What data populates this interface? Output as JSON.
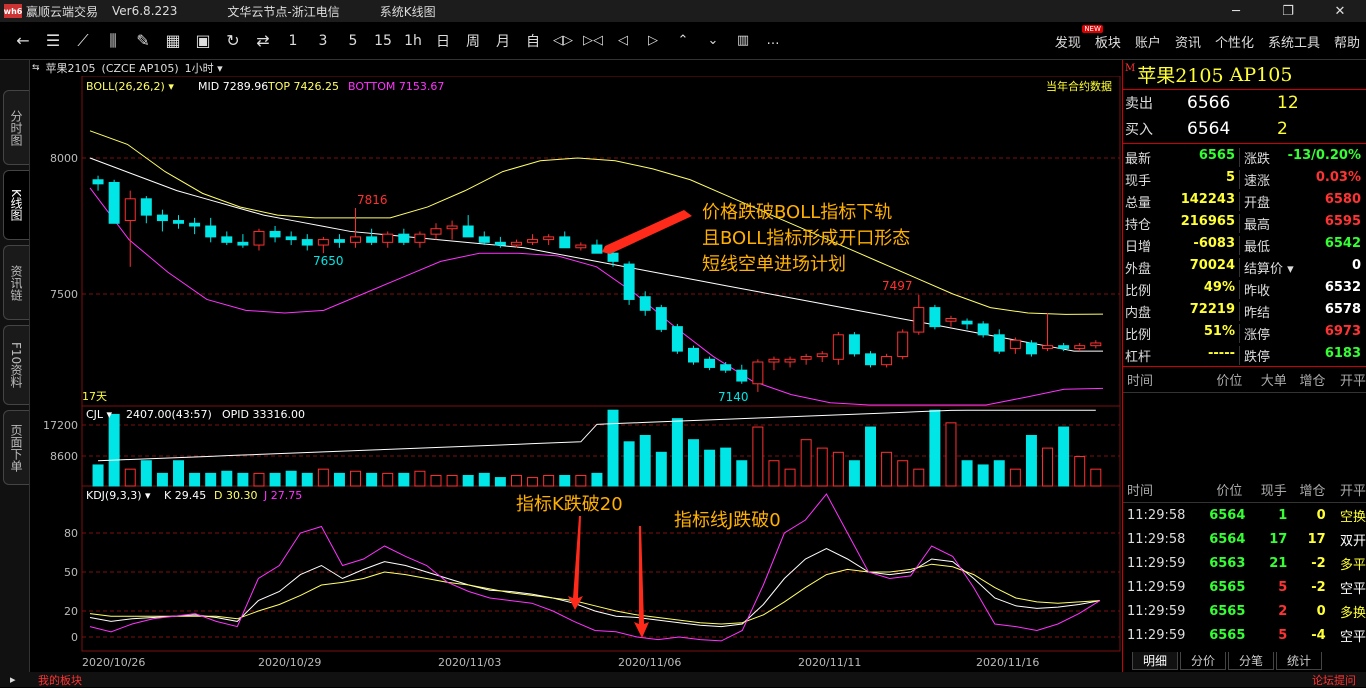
{
  "titlebar": {
    "app": "赢顺云端交易",
    "version": "Ver6.8.223",
    "node": "文华云节点-浙江电信",
    "mode": "系统K线图",
    "logo": "wh6"
  },
  "toolbar": {
    "icons": [
      "back-icon",
      "list-icon",
      "line-chart-icon",
      "candlestick-icon",
      "draw-icon",
      "grid-icon",
      "save-icon",
      "refresh-icon",
      "swap-icon"
    ],
    "periods": [
      "1",
      "3",
      "5",
      "15",
      "1h",
      "日",
      "周",
      "月",
      "自"
    ],
    "icons2": [
      "zoom-in-icon",
      "zoom-out-icon",
      "left-icon",
      "right-icon",
      "up-icon",
      "down-icon",
      "layout-icon",
      "more-icon"
    ],
    "menu": [
      "发现",
      "板块",
      "账户",
      "资讯",
      "个性化",
      "系统工具",
      "帮助"
    ],
    "new_badge": "NEW"
  },
  "left_tabs": [
    "分时图",
    "K线图",
    "资讯链",
    "F10资料",
    "页面下单"
  ],
  "chart_header": {
    "contract": "苹果2105",
    "code": "(CZCE AP105)",
    "period": "1小时"
  },
  "boll_legend": {
    "name": "BOLL(26,26,2)",
    "mid": "MID 7289.96",
    "top": "TOP 7426.25",
    "bottom": "BOTTOM 7153.67"
  },
  "contract_note": "当年合约数据",
  "days_label": "17天",
  "volume_legend": {
    "name": "CJL",
    "value": "2407.00(43:57)",
    "opid": "OPID 33316.00"
  },
  "kdj_legend": {
    "name": "KDJ(9,3,3)",
    "k": "K 29.45",
    "d": "D 30.30",
    "j": "J 27.75"
  },
  "annotations": {
    "boll": [
      "价格跌破BOLL指标下轨",
      "且BOLL指标形成开口形态",
      "短线空单进场计划"
    ],
    "k": "指标K跌破20",
    "j": "指标线J跌破0"
  },
  "price_labels": {
    "high1": "7816",
    "low1": "7650",
    "low2": "7140",
    "high2": "7497"
  },
  "colors": {
    "up": "#ff3030",
    "down": "#00e5e5",
    "mid": "#ffffff",
    "top": "#ffff66",
    "bottom": "#ff33ff",
    "k": "#ffffff",
    "d": "#ffff66",
    "j": "#ff33ff",
    "annot": "#ffb000",
    "grid": "#7a1010"
  },
  "chart_data": {
    "type": "candlestick",
    "x_ticks": [
      "2020/10/26",
      "2020/10/29",
      "2020/11/03",
      "2020/11/06",
      "2020/11/11",
      "2020/11/16"
    ],
    "price_axis": [
      "8000",
      "7500"
    ],
    "volume_axis": [
      "17200",
      "8600"
    ],
    "kdj_axis": [
      "80",
      "50",
      "20",
      "0"
    ],
    "ohlc": [
      [
        7920,
        7935,
        7880,
        7905
      ],
      [
        7910,
        7920,
        7780,
        7760
      ],
      [
        7770,
        7880,
        7600,
        7850
      ],
      [
        7850,
        7860,
        7760,
        7790
      ],
      [
        7790,
        7810,
        7730,
        7770
      ],
      [
        7770,
        7790,
        7740,
        7760
      ],
      [
        7760,
        7780,
        7720,
        7750
      ],
      [
        7750,
        7780,
        7690,
        7710
      ],
      [
        7710,
        7730,
        7680,
        7690
      ],
      [
        7690,
        7720,
        7670,
        7680
      ],
      [
        7680,
        7740,
        7660,
        7730
      ],
      [
        7730,
        7750,
        7690,
        7710
      ],
      [
        7710,
        7730,
        7680,
        7700
      ],
      [
        7700,
        7720,
        7660,
        7680
      ],
      [
        7680,
        7710,
        7650,
        7700
      ],
      [
        7700,
        7720,
        7670,
        7690
      ],
      [
        7690,
        7816,
        7670,
        7710
      ],
      [
        7710,
        7740,
        7680,
        7690
      ],
      [
        7690,
        7730,
        7670,
        7720
      ],
      [
        7720,
        7740,
        7680,
        7690
      ],
      [
        7690,
        7730,
        7670,
        7720
      ],
      [
        7720,
        7760,
        7700,
        7740
      ],
      [
        7740,
        7770,
        7700,
        7750
      ],
      [
        7750,
        7790,
        7720,
        7710
      ],
      [
        7710,
        7730,
        7680,
        7690
      ],
      [
        7690,
        7710,
        7670,
        7680
      ],
      [
        7680,
        7700,
        7670,
        7690
      ],
      [
        7690,
        7720,
        7680,
        7700
      ],
      [
        7700,
        7720,
        7680,
        7710
      ],
      [
        7710,
        7730,
        7680,
        7670
      ],
      [
        7670,
        7690,
        7660,
        7680
      ],
      [
        7680,
        7700,
        7650,
        7650
      ],
      [
        7650,
        7660,
        7600,
        7620
      ],
      [
        7610,
        7620,
        7460,
        7480
      ],
      [
        7490,
        7510,
        7420,
        7440
      ],
      [
        7450,
        7460,
        7360,
        7370
      ],
      [
        7380,
        7390,
        7280,
        7290
      ],
      [
        7300,
        7310,
        7240,
        7250
      ],
      [
        7260,
        7270,
        7220,
        7230
      ],
      [
        7240,
        7250,
        7210,
        7220
      ],
      [
        7220,
        7240,
        7170,
        7180
      ],
      [
        7170,
        7260,
        7140,
        7250
      ],
      [
        7250,
        7270,
        7220,
        7260
      ],
      [
        7250,
        7270,
        7230,
        7260
      ],
      [
        7260,
        7280,
        7240,
        7270
      ],
      [
        7270,
        7290,
        7250,
        7280
      ],
      [
        7260,
        7360,
        7240,
        7350
      ],
      [
        7350,
        7360,
        7270,
        7280
      ],
      [
        7280,
        7290,
        7230,
        7240
      ],
      [
        7240,
        7280,
        7230,
        7270
      ],
      [
        7270,
        7370,
        7260,
        7360
      ],
      [
        7360,
        7497,
        7350,
        7450
      ],
      [
        7450,
        7460,
        7370,
        7380
      ],
      [
        7400,
        7420,
        7380,
        7410
      ],
      [
        7400,
        7410,
        7370,
        7390
      ],
      [
        7390,
        7400,
        7340,
        7350
      ],
      [
        7350,
        7370,
        7280,
        7290
      ],
      [
        7300,
        7340,
        7280,
        7330
      ],
      [
        7320,
        7330,
        7270,
        7280
      ],
      [
        7300,
        7430,
        7290,
        7310
      ],
      [
        7310,
        7320,
        7290,
        7300
      ],
      [
        7300,
        7320,
        7290,
        7310
      ],
      [
        7310,
        7330,
        7300,
        7320
      ]
    ],
    "volume": [
      5000,
      17000,
      4000,
      6000,
      3000,
      6000,
      3000,
      3000,
      3500,
      3000,
      3000,
      3000,
      3500,
      3000,
      4000,
      3000,
      3500,
      3000,
      3000,
      3000,
      3500,
      2500,
      2500,
      2500,
      3000,
      2000,
      2500,
      2000,
      2500,
      2500,
      2500,
      3000,
      18000,
      10500,
      12000,
      8000,
      16000,
      11000,
      8500,
      9000,
      6000,
      14000,
      6000,
      4000,
      11000,
      9000,
      8000,
      6000,
      14000,
      8000,
      6000,
      4000,
      18000,
      15000,
      6000,
      5000,
      6000,
      4000,
      12000,
      9000,
      14000,
      7000,
      4000
    ],
    "kdj": {
      "k": [
        15,
        12,
        14,
        15,
        16,
        17,
        15,
        12,
        28,
        35,
        48,
        55,
        45,
        52,
        58,
        55,
        50,
        45,
        40,
        36,
        35,
        33,
        30,
        26,
        20,
        16,
        15,
        13,
        11,
        9,
        8,
        10,
        25,
        45,
        60,
        68,
        60,
        50,
        48,
        50,
        60,
        58,
        45,
        30,
        24,
        22,
        23,
        25,
        28
      ],
      "d": [
        18,
        16,
        16,
        16,
        16,
        16,
        16,
        14,
        20,
        25,
        32,
        40,
        42,
        45,
        50,
        48,
        45,
        42,
        40,
        37,
        34,
        32,
        30,
        28,
        24,
        20,
        17,
        15,
        13,
        11,
        10,
        11,
        17,
        27,
        38,
        48,
        52,
        50,
        50,
        52,
        56,
        54,
        48,
        38,
        30,
        27,
        26,
        27,
        28
      ],
      "j": [
        8,
        4,
        10,
        14,
        16,
        18,
        12,
        8,
        45,
        55,
        80,
        85,
        55,
        60,
        70,
        62,
        55,
        42,
        35,
        30,
        28,
        26,
        20,
        12,
        5,
        4,
        0,
        -2,
        0,
        -2,
        -3,
        5,
        40,
        80,
        90,
        110,
        80,
        50,
        45,
        47,
        70,
        62,
        38,
        10,
        8,
        5,
        10,
        18,
        28
      ]
    },
    "bands": {
      "mid": [
        8000,
        7960,
        7920,
        7880,
        7850,
        7820,
        7790,
        7770,
        7750,
        7730,
        7720,
        7710,
        7700,
        7690,
        7680,
        7670,
        7650,
        7630,
        7610,
        7590,
        7570,
        7550,
        7530,
        7510,
        7490,
        7470,
        7450,
        7430,
        7410,
        7390,
        7370,
        7350,
        7330,
        7310,
        7290,
        7290
      ],
      "top": [
        8100,
        8050,
        7950,
        7870,
        7820,
        7790,
        7780,
        7780,
        7780,
        7820,
        7880,
        7950,
        7990,
        8000,
        7990,
        7960,
        7920,
        7860,
        7800,
        7740,
        7680,
        7620,
        7560,
        7500,
        7450,
        7430,
        7425,
        7426
      ],
      "bottom": [
        7890,
        7700,
        7580,
        7480,
        7440,
        7430,
        7440,
        7500,
        7560,
        7620,
        7650,
        7650,
        7640,
        7600,
        7500,
        7380,
        7270,
        7180,
        7130,
        7100,
        7080,
        7070,
        7070,
        7080,
        7120,
        7150,
        7153
      ]
    }
  },
  "right_panel": {
    "title": "苹果2105",
    "code": "AP105",
    "mark": "M",
    "ask": {
      "label": "卖出",
      "price": "6566",
      "vol": "12"
    },
    "bid": {
      "label": "买入",
      "price": "6564",
      "vol": "2"
    },
    "quotes": [
      {
        "l": "最新",
        "lv": "6565",
        "lc": "#33ff33",
        "r": "涨跌",
        "rv": "-13/0.20%",
        "rc": "#33ff33"
      },
      {
        "l": "现手",
        "lv": "5",
        "lc": "#ffff33",
        "r": "速涨",
        "rv": "0.03%",
        "rc": "#ff3333"
      },
      {
        "l": "总量",
        "lv": "142243",
        "lc": "#ffff33",
        "r": "开盘",
        "rv": "6580",
        "rc": "#ff3333"
      },
      {
        "l": "持仓",
        "lv": "216965",
        "lc": "#ffff33",
        "r": "最高",
        "rv": "6595",
        "rc": "#ff3333"
      },
      {
        "l": "日增",
        "lv": "-6083",
        "lc": "#ffff33",
        "r": "最低",
        "rv": "6542",
        "rc": "#33ff33"
      },
      {
        "l": "外盘",
        "lv": "70024",
        "lc": "#ffff33",
        "r": "结算价",
        "rv": "0",
        "rc": "#ffffff"
      },
      {
        "l": "比例",
        "lv": "49%",
        "lc": "#ffff33",
        "r": "昨收",
        "rv": "6532",
        "rc": "#ffffff"
      },
      {
        "l": "内盘",
        "lv": "72219",
        "lc": "#ffff33",
        "r": "昨结",
        "rv": "6578",
        "rc": "#ffffff"
      },
      {
        "l": "比例",
        "lv": "51%",
        "lc": "#ffff33",
        "r": "涨停",
        "rv": "6973",
        "rc": "#ff3333"
      },
      {
        "l": "杠杆",
        "lv": "-----",
        "lc": "#ffff33",
        "r": "跌停",
        "rv": "6183",
        "rc": "#33ff33"
      }
    ],
    "big_header": [
      "时间",
      "价位",
      "大单",
      "增仓",
      "开平"
    ],
    "tick_header": [
      "时间",
      "价位",
      "现手",
      "增仓",
      "开平"
    ],
    "ticks": [
      {
        "t": "11:29:58",
        "p": "6564",
        "v": "1",
        "vc": "#33ff33",
        "z": "0",
        "o": "空换",
        "oc": "#ffff33"
      },
      {
        "t": "11:29:58",
        "p": "6564",
        "v": "17",
        "vc": "#33ff33",
        "z": "17",
        "o": "双开",
        "oc": "#ffffff"
      },
      {
        "t": "11:29:59",
        "p": "6563",
        "v": "21",
        "vc": "#33ff33",
        "z": "-2",
        "o": "多平",
        "oc": "#ffff33"
      },
      {
        "t": "11:29:59",
        "p": "6565",
        "v": "5",
        "vc": "#ff3333",
        "z": "-2",
        "o": "空平",
        "oc": "#ffffff"
      },
      {
        "t": "11:29:59",
        "p": "6565",
        "v": "2",
        "vc": "#ff3333",
        "z": "0",
        "o": "多换",
        "oc": "#ffff33"
      },
      {
        "t": "11:29:59",
        "p": "6565",
        "v": "5",
        "vc": "#ff3333",
        "z": "-4",
        "o": "空平",
        "oc": "#ffffff"
      }
    ],
    "tabs": [
      "明细",
      "分价",
      "分笔",
      "统计"
    ]
  },
  "status": {
    "left": "我的板块",
    "right": "论坛提问"
  }
}
